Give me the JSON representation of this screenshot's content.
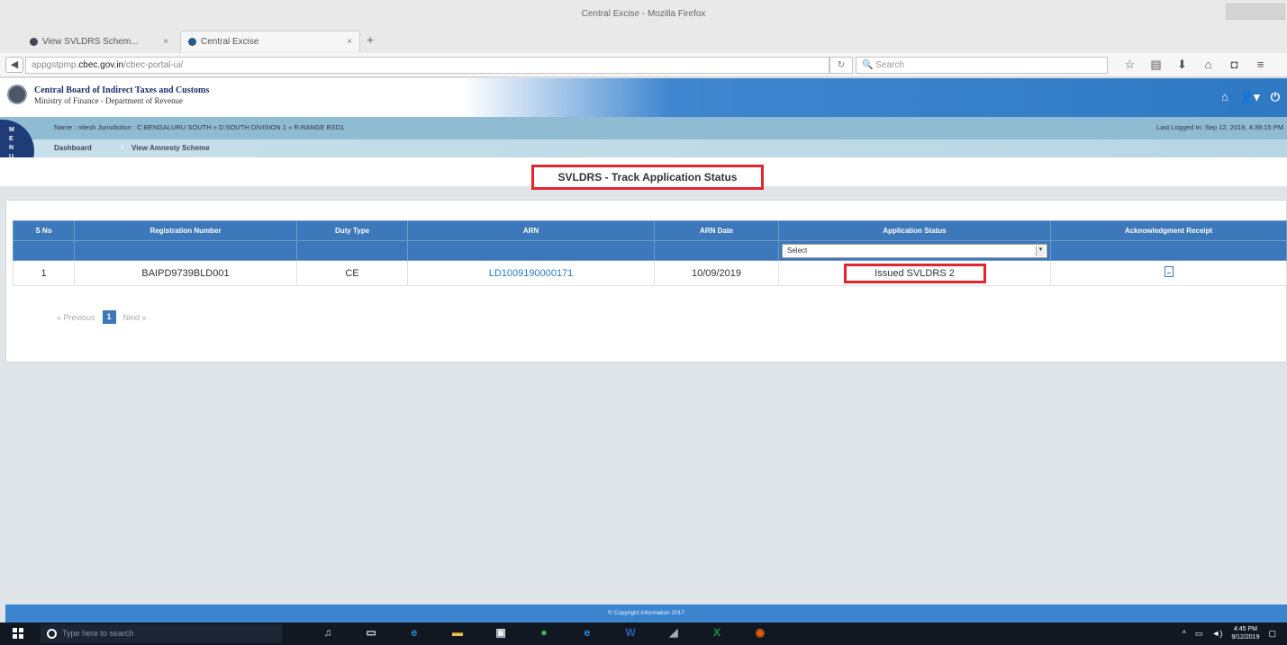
{
  "window": {
    "title": "Central Excise - Mozilla Firefox"
  },
  "tabs": [
    {
      "label": "View SVLDRS Schem...",
      "close": "×"
    },
    {
      "label": "Central Excise",
      "close": "×"
    }
  ],
  "newtab": "+",
  "url": {
    "prefix": "appgstpmp.",
    "domain": "cbec.gov.in",
    "suffix": "/cbec-portal-ui/"
  },
  "browser_search": {
    "placeholder": "Search"
  },
  "header": {
    "org_name": "Central Board of Indirect Taxes and Customs",
    "org_sub": "Ministry of Finance - Department of Revenue"
  },
  "menu_label": [
    "M",
    "E",
    "N",
    "U"
  ],
  "infobar": {
    "user": "Name : nitesh    Jurisdiction : C:BENGALURU SOUTH » D:SOUTH DIVISION 1 » R:RANGE BSD1",
    "last_logged": "Last Logged In: Sep 12, 2019, 4:39:15 PM"
  },
  "breadcrumb": {
    "item1": "Dashboard",
    "item2": "View Amnesty Scheme"
  },
  "page_title": "SVLDRS - Track Application Status",
  "table": {
    "headers": [
      "S No",
      "Registration Number",
      "Duty Type",
      "ARN",
      "ARN Date",
      "Application Status",
      "Acknowledgment Receipt"
    ],
    "filter_select": "Select",
    "rows": [
      {
        "sno": "1",
        "reg": "BAIPD9739BLD001",
        "duty": "CE",
        "arn": "LD1009190000171",
        "date": "10/09/2019",
        "status": "Issued SVLDRS 2"
      }
    ]
  },
  "pager": {
    "previous": "« Previous",
    "page": "1",
    "next": "Next »"
  },
  "footer": "© Copyright Information 2017",
  "taskbar": {
    "search_placeholder": "Type here to search",
    "time": "4:45 PM",
    "date": "9/12/2019"
  },
  "colors": {
    "brand_blue": "#3d78ba",
    "highlight_red": "#e0262e",
    "link": "#2a78c6"
  }
}
